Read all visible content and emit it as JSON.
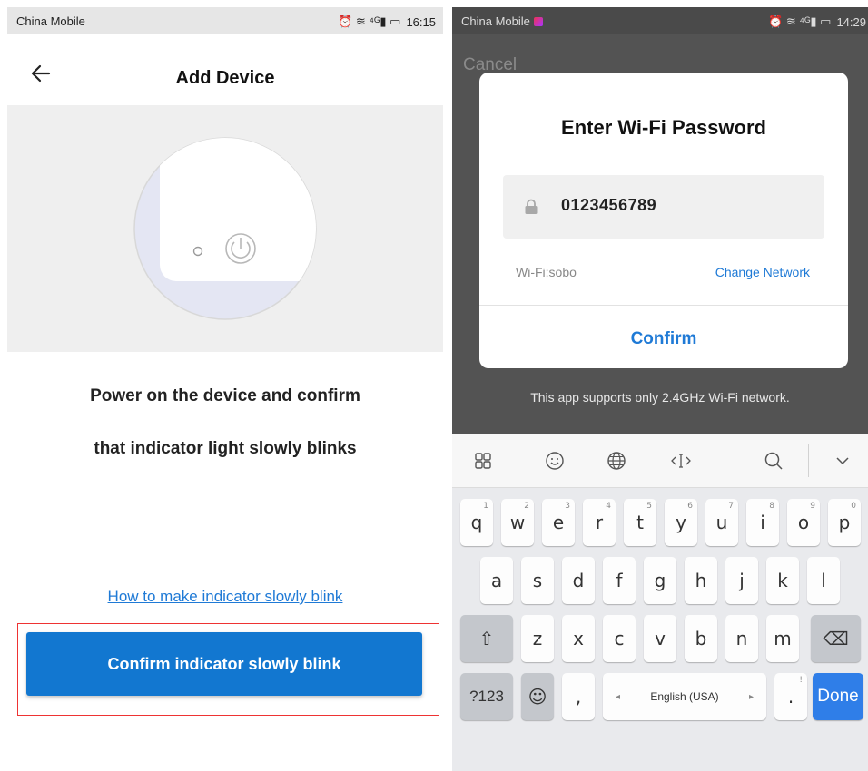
{
  "left": {
    "status": {
      "carrier": "China Mobile",
      "icons": "⏰ ≋ ⁴ᴳ▮ ▭",
      "time": "16:15"
    },
    "header": {
      "title": "Add Device"
    },
    "instructions": [
      "Power on the device and confirm",
      "that indicator light slowly blinks"
    ],
    "help_link": "How to make indicator slowly blink",
    "confirm_button": "Confirm indicator slowly blink",
    "highlight_color": "#e33333",
    "accent_color": "#1277d0"
  },
  "right": {
    "status": {
      "carrier": "China Mobile",
      "icons": "⏰ ≋ ⁴ᴳ▮ ▭",
      "time": "14:29"
    },
    "cancel_label": "Cancel",
    "dialog": {
      "title": "Enter Wi-Fi Password",
      "password_value": "0123456789",
      "wifi_label": "Wi-Fi:sobo",
      "change_network": "Change Network",
      "confirm": "Confirm"
    },
    "note": "This app supports only 2.4GHz Wi-Fi network.",
    "keyboard": {
      "row1": [
        {
          "k": "q",
          "h": "1"
        },
        {
          "k": "w",
          "h": "2"
        },
        {
          "k": "e",
          "h": "3"
        },
        {
          "k": "r",
          "h": "4"
        },
        {
          "k": "t",
          "h": "5"
        },
        {
          "k": "y",
          "h": "6"
        },
        {
          "k": "u",
          "h": "7"
        },
        {
          "k": "i",
          "h": "8"
        },
        {
          "k": "o",
          "h": "9"
        },
        {
          "k": "p",
          "h": "0"
        }
      ],
      "row2": [
        "a",
        "s",
        "d",
        "f",
        "g",
        "h",
        "j",
        "k",
        "l"
      ],
      "row3": [
        "z",
        "x",
        "c",
        "v",
        "b",
        "n",
        "m"
      ],
      "shift": "⇧",
      "backspace": "⌫",
      "sym": "?123",
      "emoji": "☺",
      "comma": ",",
      "space_label": "English (USA)",
      "space_left": "◂",
      "space_right": "▸",
      "period": ".",
      "period_hint": "!",
      "done": "Done",
      "toolbar_icons": [
        "apps-grid-icon",
        "emoji-icon",
        "globe-icon",
        "cursor-icon",
        "search-icon",
        "chevron-down-icon"
      ]
    }
  }
}
